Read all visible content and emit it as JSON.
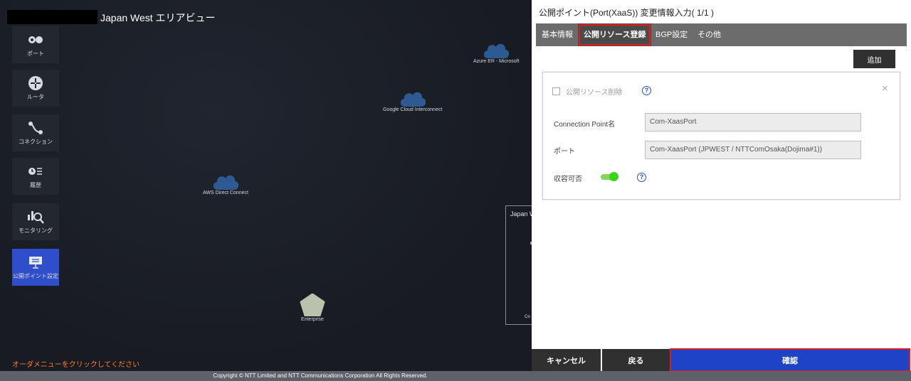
{
  "map": {
    "title": "Japan West エリアビュー",
    "order_message": "オーダメニューをクリックしてください",
    "sidebar": [
      {
        "label": "ポート",
        "icon": "port-icon"
      },
      {
        "label": "ルータ",
        "icon": "router-icon"
      },
      {
        "label": "コネクション",
        "icon": "connection-icon"
      },
      {
        "label": "履歴",
        "icon": "history-icon"
      },
      {
        "label": "モニタリング",
        "icon": "monitoring-icon"
      },
      {
        "label": "公開ポイント設定",
        "icon": "public-point-icon",
        "active": true
      }
    ],
    "clouds": [
      {
        "label": "Azure ER - Microsoft"
      },
      {
        "label": "Google Cloud Interconnect"
      },
      {
        "label": "AWS Direct Connect"
      }
    ],
    "enterprise_label": "Enterprise",
    "box_title": "Japan W",
    "box_caption": "Co"
  },
  "dialog": {
    "title": "公開ポイント(Port(XaaS)) 変更情報入力( 1/1 )",
    "tabs": [
      "基本情報",
      "公開リソース登録",
      "BGP設定",
      "その他"
    ],
    "active_tab": "公開リソース登録",
    "add_label": "追加",
    "delete_checkbox_label": "公開リソース削除",
    "connection_point_label": "Connection Point名",
    "connection_point_value": "Com-XaasPort",
    "port_label": "ポート",
    "port_value": "Com-XaasPort (JPWEST / NTTComOsaka(Dojima#1))",
    "capacity_label": "収容可否",
    "capacity_enabled": true,
    "help_glyph": "?",
    "close_glyph": "×",
    "cancel_label": "キャンセル",
    "back_label": "戻る",
    "confirm_label": "確認"
  },
  "footer": "Copyright © NTT Limited and NTT Communications Corporation All Rights Reserved.",
  "colors": {
    "accent": "#1f43c6",
    "highlight": "#e21b1b",
    "toggle": "#3ed11a",
    "warning_text": "#ff7a2e"
  }
}
